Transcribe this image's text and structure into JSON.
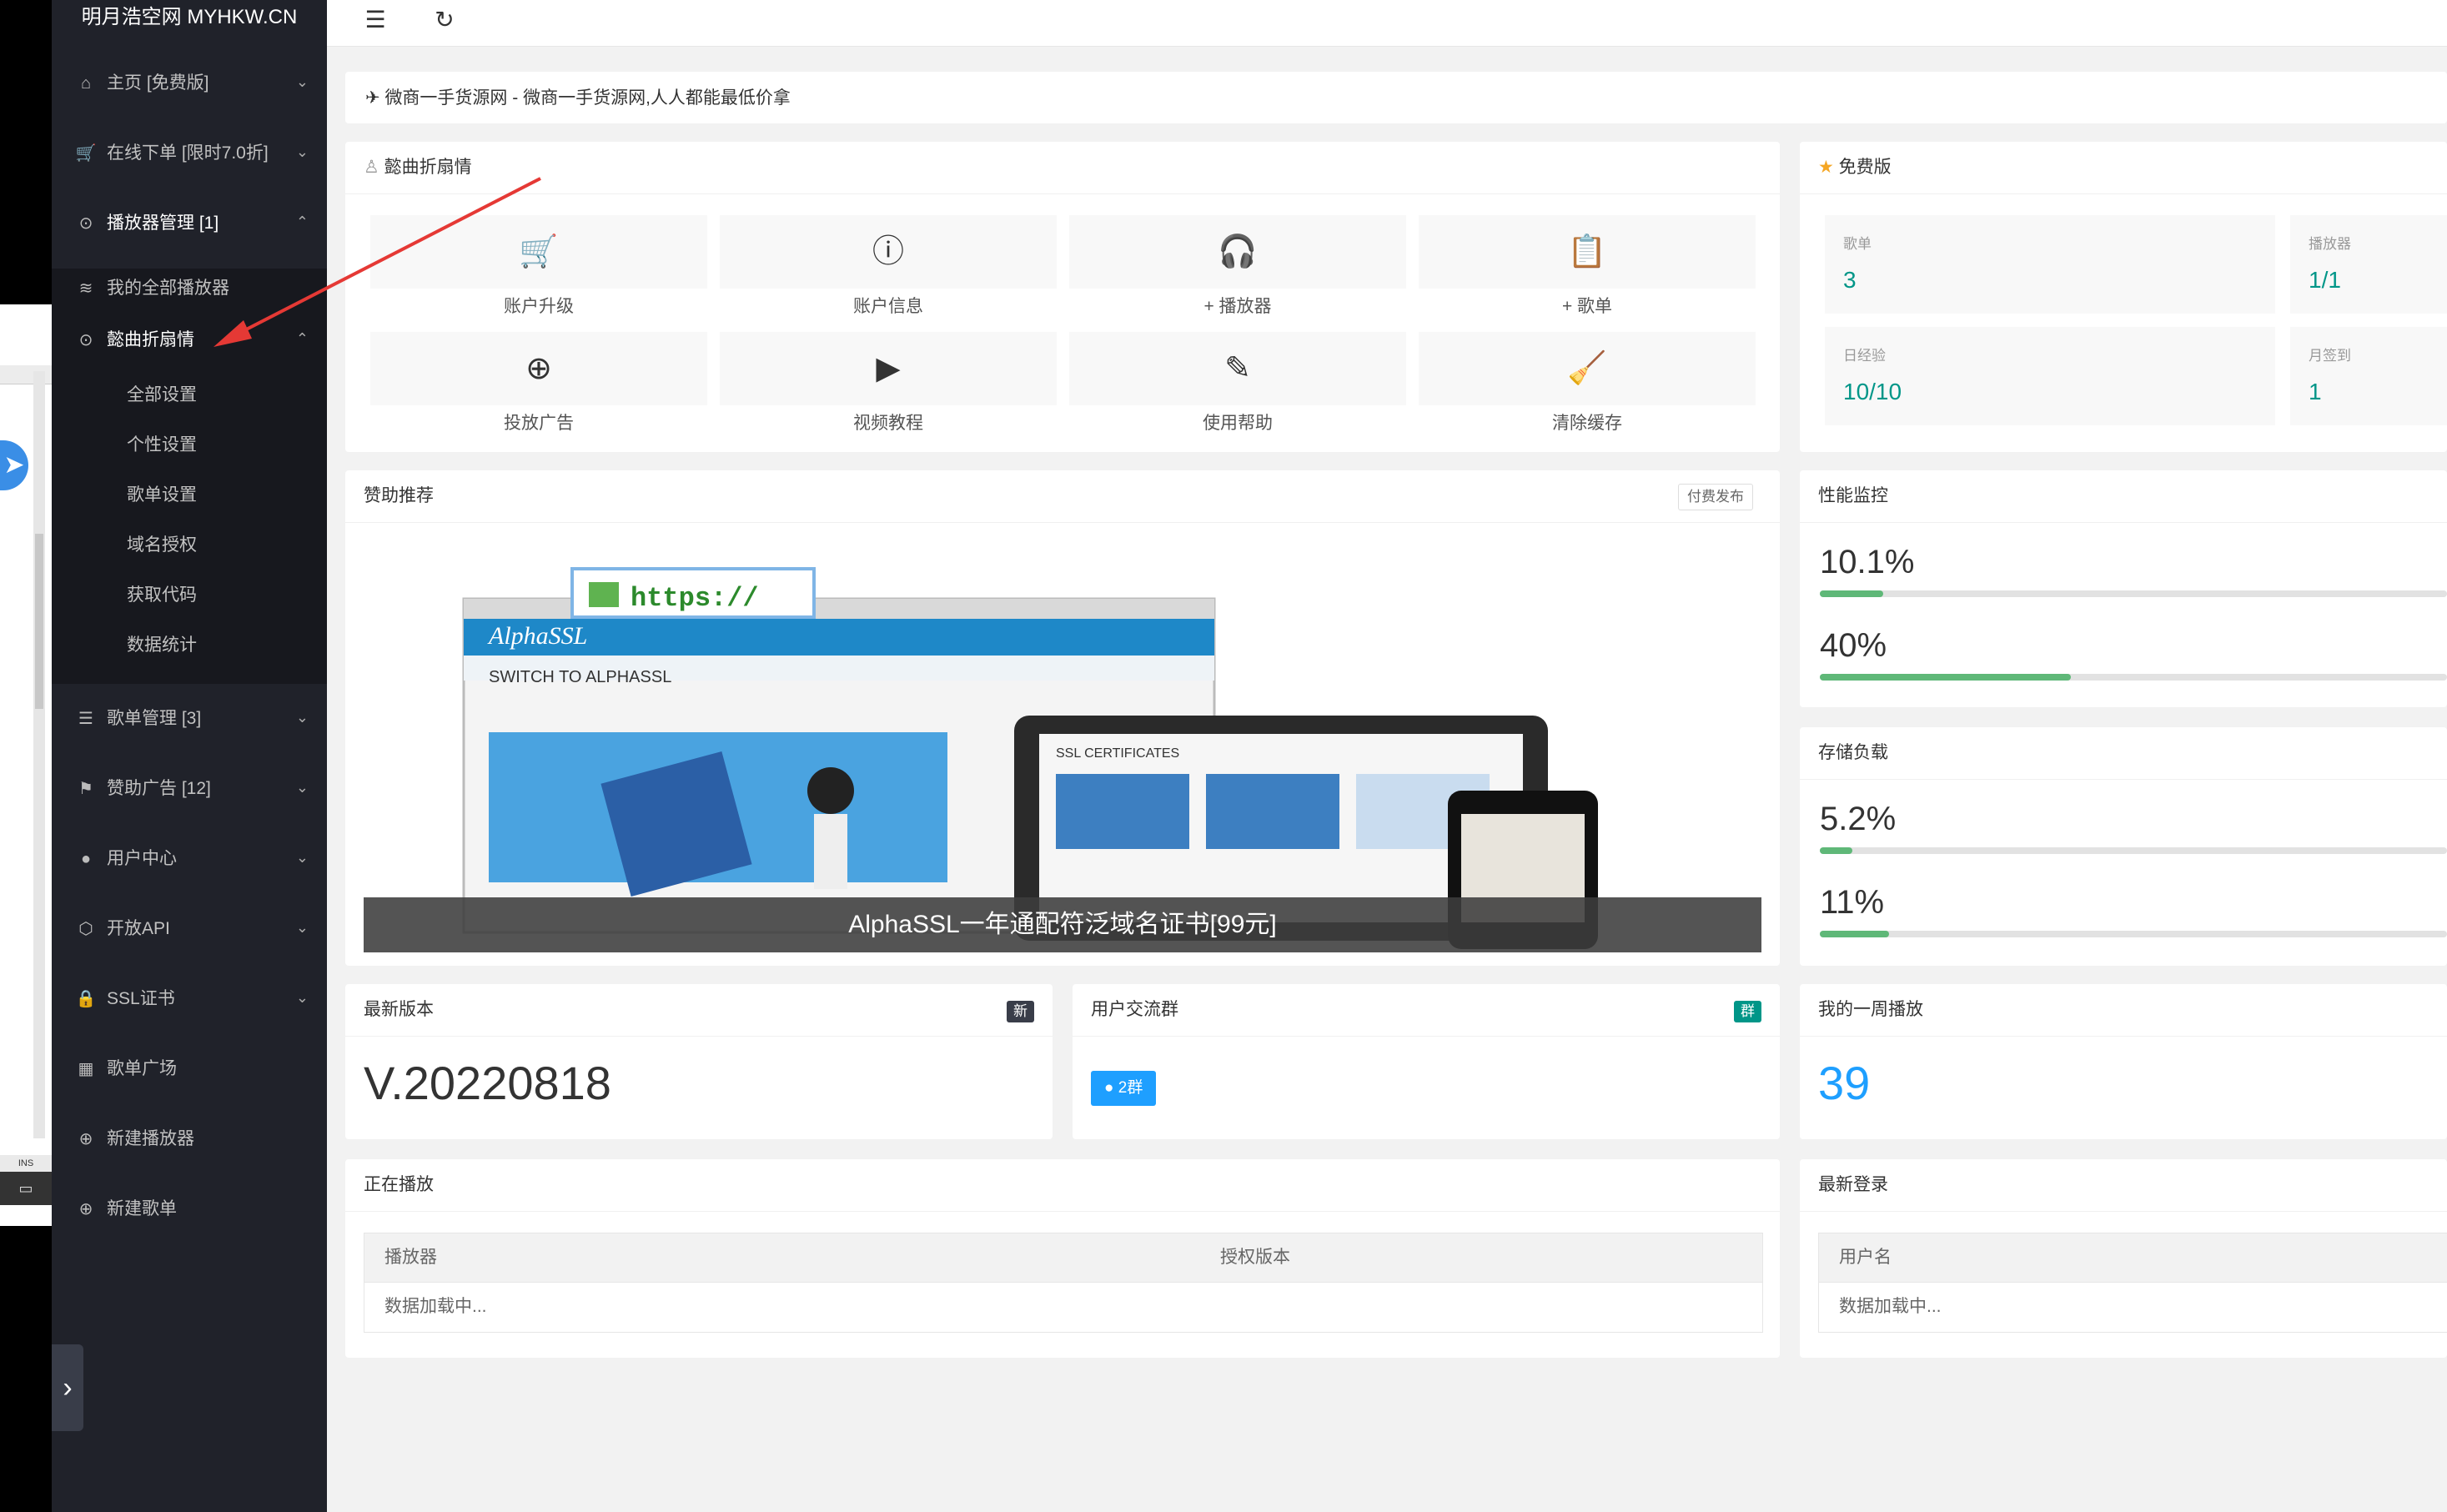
{
  "background_window": {
    "ins_label": "INS"
  },
  "sidebar": {
    "logo": "明月浩空网 MYHKW.CN",
    "items": [
      {
        "label": "主页 [免费版]",
        "icon": "home-icon"
      },
      {
        "label": "在线下单 [限时7.0折]",
        "icon": "cart-icon"
      },
      {
        "label": "播放器管理 [1]",
        "icon": "play-circle-icon"
      },
      {
        "label": "我的全部播放器",
        "icon": "layers-icon"
      },
      {
        "label": "懿曲折扇情",
        "icon": "play-circle-icon"
      },
      {
        "label": "歌单管理 [3]",
        "icon": "list-icon"
      },
      {
        "label": "赞助广告 [12]",
        "icon": "flag-icon"
      },
      {
        "label": "用户中心",
        "icon": "user-icon"
      },
      {
        "label": "开放API",
        "icon": "cube-icon"
      },
      {
        "label": "SSL证书",
        "icon": "lock-icon"
      },
      {
        "label": "歌单广场",
        "icon": "grid-icon"
      },
      {
        "label": "新建播放器",
        "icon": "add-circle-icon"
      },
      {
        "label": "新建歌单",
        "icon": "add-circle-icon"
      }
    ],
    "subitems": [
      "全部设置",
      "个性设置",
      "歌单设置",
      "域名授权",
      "获取代码",
      "数据统计"
    ]
  },
  "notice": {
    "text": "微商一手货源网 - 微商一手货源网,人人都能最低价拿"
  },
  "quick": {
    "title": "懿曲折扇情",
    "items": [
      "账户升级",
      "账户信息",
      "+ 播放器",
      "+ 歌单",
      "投放广告",
      "视频教程",
      "使用帮助",
      "清除缓存"
    ]
  },
  "plan": {
    "title": "免费版",
    "stats": [
      {
        "k": "歌单",
        "v": "3"
      },
      {
        "k": "播放器",
        "v": "1/1"
      },
      {
        "k": "日经验",
        "v": "10/10"
      },
      {
        "k": "月签到",
        "v": "1"
      }
    ]
  },
  "sponsor": {
    "title": "赞助推荐",
    "tag": "付费发布",
    "caption": "AlphaSSL一年通配符泛域名证书[99元]",
    "image_text": {
      "url_badge": "https://",
      "brand": "AlphaSSL",
      "switch_headline": "SWITCH TO ALPHASSL",
      "tablet_heading": "SSL CERTIFICATES"
    }
  },
  "perf": {
    "title": "性能监控",
    "values": [
      "10.1%",
      "40%"
    ],
    "fractions": [
      0.101,
      0.4
    ]
  },
  "storage": {
    "title": "存储负载",
    "values": [
      "5.2%",
      "11%"
    ],
    "fractions": [
      0.052,
      0.11
    ]
  },
  "version": {
    "title": "最新版本",
    "tag": "新",
    "value": "V.20220818"
  },
  "group": {
    "title": "用户交流群",
    "tag": "群",
    "button": "2群"
  },
  "weekly": {
    "title": "我的一周播放",
    "value": "39"
  },
  "playing": {
    "title": "正在播放",
    "col1": "播放器",
    "col2": "授权版本",
    "loading": "数据加载中..."
  },
  "login": {
    "title": "最新登录",
    "col1": "用户名",
    "loading": "数据加载中..."
  },
  "colors": {
    "sidebar": "#20222a",
    "accent": "#009688",
    "progress": "#5fb878",
    "link": "#1e9fff",
    "arrow": "#e53935"
  }
}
